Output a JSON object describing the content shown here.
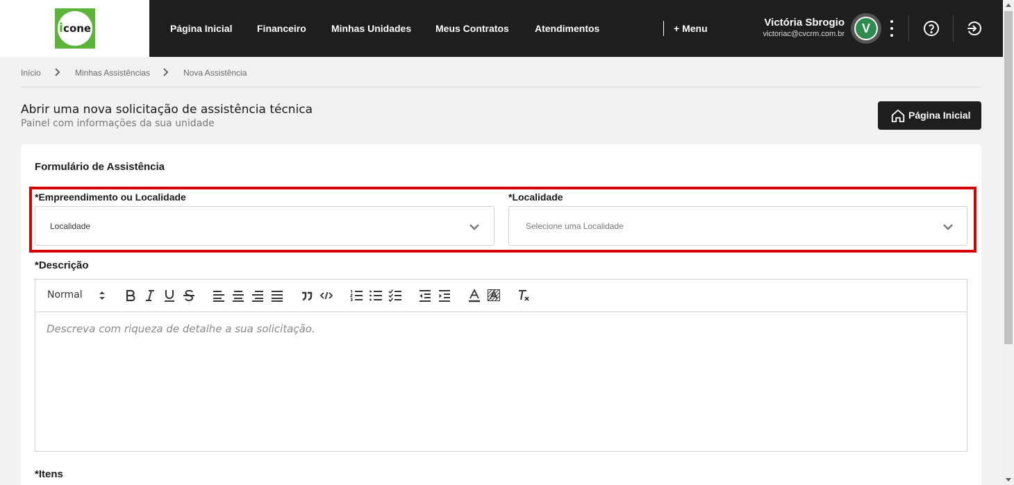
{
  "brand": {
    "logo_text": "icone",
    "logo_color": "#5bb53a"
  },
  "nav": {
    "items": [
      "Página Inicial",
      "Financeiro",
      "Minhas Unidades",
      "Meus Contratos",
      "Atendimentos"
    ],
    "more_label": "+ Menu"
  },
  "user": {
    "name": "Victória Sbrogio",
    "email": "victoriac@cvcrm.com.br",
    "avatar_letter": "V",
    "avatar_color": "#2f8a4f"
  },
  "header_icons": [
    "more-vertical-icon",
    "help-icon",
    "logout-icon"
  ],
  "breadcrumb": [
    "Início",
    "Minhas Assistências",
    "Nova Assistência"
  ],
  "page": {
    "title": "Abrir uma nova solicitação de assistência técnica",
    "subtitle": "Painel com informações da sua unidade",
    "home_button": "Página Inicial"
  },
  "form": {
    "title": "Formulário de Assistência",
    "highlight_color": "#d40000",
    "empreendimento": {
      "label": "*Empreendimento ou Localidade",
      "value": "Localidade"
    },
    "localidade": {
      "label": "*Localidade",
      "placeholder": "Selecione uma Localidade"
    },
    "descricao": {
      "label": "*Descrição",
      "heading_select": "Normal",
      "placeholder": "Descreva com riqueza de detalhe a sua solicitação."
    },
    "itens_label": "*Itens"
  },
  "toolbar_icons": [
    "bold-icon",
    "italic-icon",
    "underline-icon",
    "strikethrough-icon",
    "align-left-icon",
    "align-center-icon",
    "align-right-icon",
    "align-justify-icon",
    "blockquote-icon",
    "code-icon",
    "ordered-list-icon",
    "bullet-list-icon",
    "check-list-icon",
    "outdent-icon",
    "indent-icon",
    "text-color-icon",
    "background-color-icon",
    "clear-format-icon"
  ]
}
